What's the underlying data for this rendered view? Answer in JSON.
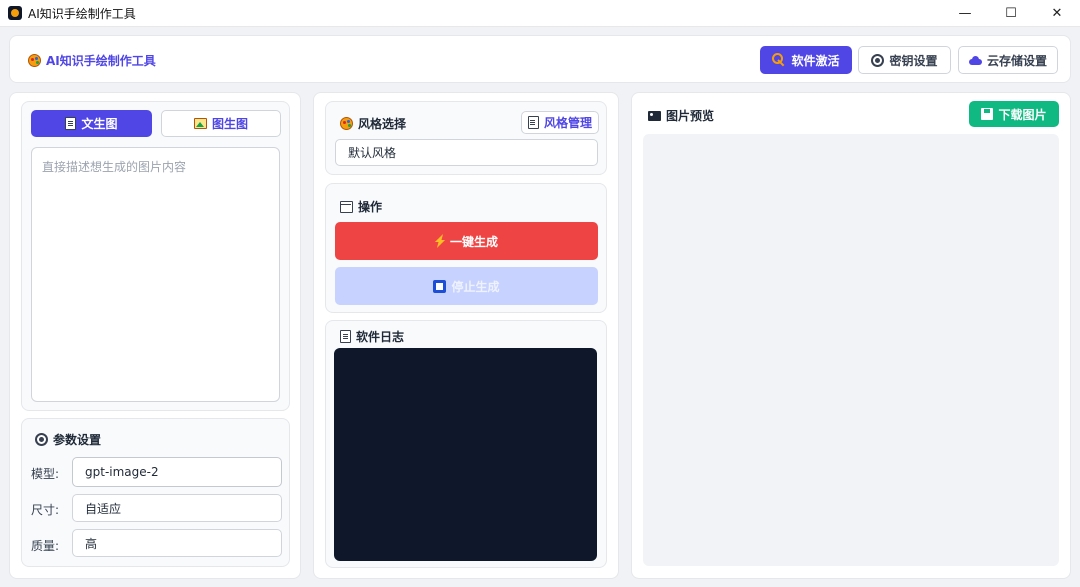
{
  "window": {
    "title": "AI知识手绘制作工具",
    "controls": {
      "minimize": "—",
      "maximize": "☐",
      "close": "✕"
    }
  },
  "header": {
    "title": "AI知识手绘制作工具",
    "buttons": {
      "activate": "软件激活",
      "key_settings": "密钥设置",
      "cloud_settings": "云存储设置"
    }
  },
  "left": {
    "tabs": {
      "text_to_image": "文生图",
      "image_to_image": "图生图"
    },
    "prompt_placeholder": "直接描述想生成的图片内容",
    "params": {
      "title": "参数设置",
      "model_label": "模型:",
      "model_value": "gpt-image-2",
      "size_label": "尺寸:",
      "size_value": "自适应",
      "quality_label": "质量:",
      "quality_value": "高"
    }
  },
  "middle": {
    "style": {
      "title": "风格选择",
      "manage_button": "风格管理",
      "value": "默认风格"
    },
    "ops": {
      "title": "操作",
      "generate_button": "一键生成",
      "stop_button": "停止生成"
    },
    "log": {
      "title": "软件日志"
    }
  },
  "right": {
    "title": "图片预览",
    "download_button": "下载图片"
  },
  "colors": {
    "primary": "#4f46e5",
    "danger": "#ef4444",
    "disabled": "#c7d2fe",
    "success": "#10b981",
    "log_bg": "#0f172a"
  }
}
